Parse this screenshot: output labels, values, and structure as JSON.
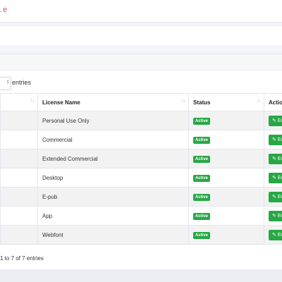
{
  "header": {
    "brand_fragment": ".e"
  },
  "table_controls": {
    "select_arrow": "↕",
    "entries_label": "entries"
  },
  "table": {
    "columns": [
      "",
      "License Name",
      "Status",
      "Actio"
    ],
    "rows": [
      {
        "id": "",
        "name": "Personal Use Only",
        "status": "Active",
        "action": "Ec"
      },
      {
        "id": "",
        "name": "Commercial",
        "status": "Active",
        "action": "Ec"
      },
      {
        "id": "",
        "name": "Extended Commercial",
        "status": "Active",
        "action": "Ec"
      },
      {
        "id": "",
        "name": "Desktop",
        "status": "Active",
        "action": "Ec"
      },
      {
        "id": "",
        "name": "E-pub",
        "status": "Active",
        "action": "Ec"
      },
      {
        "id": "",
        "name": "App",
        "status": "Active",
        "action": "Ec"
      },
      {
        "id": "",
        "name": "Webfont",
        "status": "Active",
        "action": "Ec"
      }
    ],
    "sort_icon": "↑↓",
    "edit_icon": "✎"
  },
  "pagination": {
    "info": "1 to 7 of 7 entries"
  },
  "colors": {
    "active": "#28a745",
    "brand": "#e83e8c"
  }
}
